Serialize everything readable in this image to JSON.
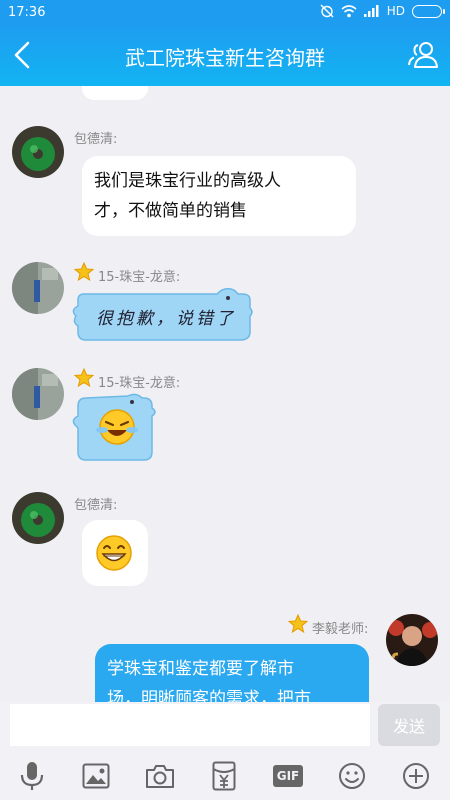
{
  "status_bar": {
    "time": "17:36",
    "network": "HD"
  },
  "header": {
    "title": "武工院珠宝新生咨询群",
    "back_icon": "chevron-left-icon",
    "members_icon": "group-members-icon"
  },
  "messages": [
    {
      "sender": "包德清:",
      "text_line1": "我们是珠宝行业的高级人",
      "text_line2": "才，不做简单的销售"
    },
    {
      "sender": "15-珠宝-龙意:",
      "sticker_text": "很抱歉，说错了"
    },
    {
      "sender": "15-珠宝-龙意:",
      "sticker": "crying-laughing-emoji"
    },
    {
      "sender": "包德清:",
      "sticker": "grinning-emoji"
    },
    {
      "sender": "李毅老师:",
      "text_line1": "学珠宝和鉴定都要了解市",
      "text_line2": "场，明晰顾客的需求，把市"
    }
  ],
  "composer": {
    "input_value": "",
    "send_label": "发送"
  },
  "toolbar": {
    "gif_label": "GIF",
    "icons": [
      "microphone-icon",
      "image-icon",
      "camera-icon",
      "red-packet-icon",
      "gif-icon",
      "emoji-icon",
      "plus-icon"
    ]
  },
  "colors": {
    "header": "#1e9df0",
    "bubble_blue": "#2aa8f0",
    "cloud_blue": "#9fd6f5",
    "background": "#f0f0f4"
  }
}
